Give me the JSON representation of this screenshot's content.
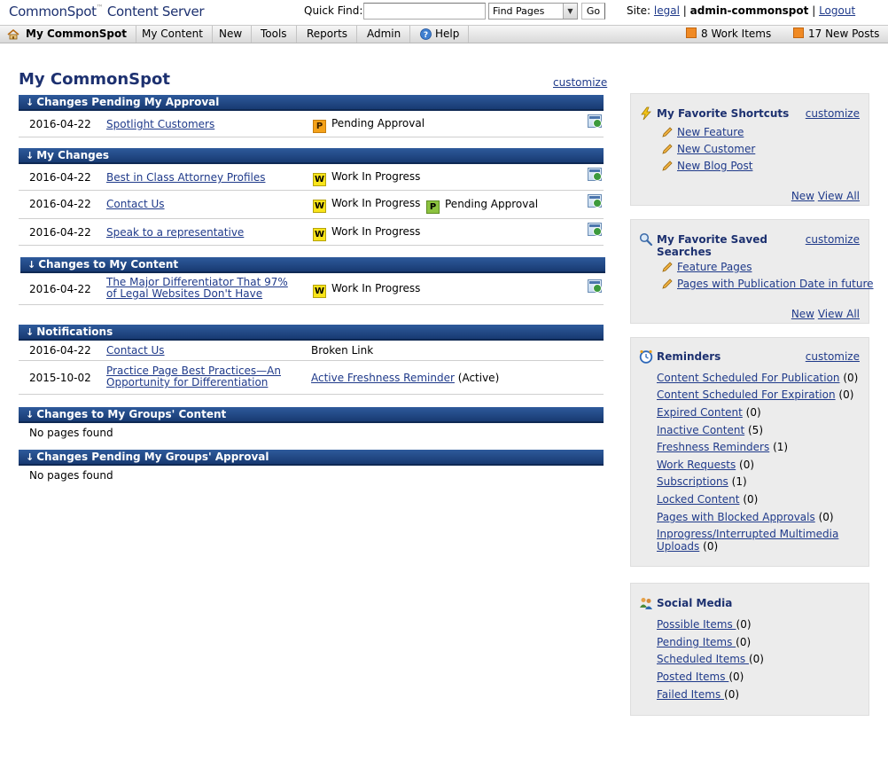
{
  "app": {
    "logo_name": "CommonSpot",
    "logo_tm": "™",
    "logo_product": "Content Server"
  },
  "quickfind": {
    "label": "Quick Find:",
    "input_value": "",
    "select_value": "Find Pages",
    "go_label": "Go"
  },
  "site": {
    "label": "Site:",
    "name": "legal",
    "separator": "|",
    "user": "admin-commonspot",
    "logout": "Logout"
  },
  "menu": {
    "items": [
      "My CommonSpot",
      "My Content",
      "New",
      "Tools",
      "Reports",
      "Admin",
      "Help"
    ],
    "work_items": "8 Work Items",
    "new_posts": "17 New Posts"
  },
  "main": {
    "title": "My CommonSpot",
    "customize": "customize",
    "arrow": "↓",
    "sections": [
      {
        "header": "Changes Pending My Approval",
        "rows": [
          {
            "date": "2016-04-22",
            "title": "Spotlight Customers",
            "status1_badge": "P",
            "status1": "Pending Approval"
          }
        ]
      },
      {
        "header": "My Changes",
        "rows": [
          {
            "date": "2016-04-22",
            "title": "Best in Class Attorney Profiles",
            "status1_badge": "W",
            "status1": "Work In Progress"
          },
          {
            "date": "2016-04-22",
            "title": "Contact Us",
            "status1_badge": "W",
            "status1": "Work In Progress",
            "status2_badge": "P",
            "status2": "Pending Approval"
          },
          {
            "date": "2016-04-22",
            "title": "Speak to a representative",
            "status1_badge": "W",
            "status1": "Work In Progress"
          }
        ]
      },
      {
        "header": "Changes to My Content",
        "rows": [
          {
            "date": "2016-04-22",
            "title_line1": "The Major Differentiator That 97%",
            "title_line2": "of Legal Websites Don't Have",
            "status1_badge": "W",
            "status1": "Work In Progress"
          }
        ]
      },
      {
        "header": "Notifications",
        "rows": [
          {
            "date": "2016-04-22",
            "title": "Contact Us",
            "note": "Broken Link"
          },
          {
            "date": "2015-10-02",
            "title_line1": "Practice Page Best Practices—An",
            "title_line2": "Opportunity for Differentiation",
            "note_link": "Active Freshness Reminder",
            "note_suffix": "(Active)"
          }
        ]
      },
      {
        "header": "Changes to My Groups' Content",
        "empty": "No pages found"
      },
      {
        "header": "Changes Pending My Groups' Approval",
        "empty": "No pages found"
      }
    ]
  },
  "sidebar": {
    "shortcuts": {
      "title": "My Favorite Shortcuts",
      "customize": "customize",
      "items": [
        "New Feature",
        "New Customer",
        "New Blog Post"
      ],
      "new": "New",
      "view_all": "View All"
    },
    "searches": {
      "title_line1": "My Favorite Saved",
      "title_line2": "Searches",
      "customize": "customize",
      "items": [
        "Feature Pages",
        "Pages with Publication Date in future"
      ],
      "new": "New",
      "view_all": "View All"
    },
    "reminders": {
      "title": "Reminders",
      "customize": "customize",
      "items": [
        {
          "label": "Content Scheduled For Publication",
          "count": "(0)"
        },
        {
          "label": "Content Scheduled For Expiration",
          "count": "(0)"
        },
        {
          "label": "Expired Content",
          "count": "(0)"
        },
        {
          "label": "Inactive Content",
          "count": "(5)"
        },
        {
          "label": "Freshness Reminders",
          "count": "(1)"
        },
        {
          "label": "Work Requests",
          "count": "(0)"
        },
        {
          "label": "Subscriptions",
          "count": "(1)"
        },
        {
          "label": "Locked Content",
          "count": "(0)"
        },
        {
          "label": "Pages with Blocked Approvals",
          "count": "(0)"
        },
        {
          "label_line1": "Inprogress/Interrupted Multimedia",
          "label_line2": "Uploads",
          "count": "(0)"
        }
      ]
    },
    "social": {
      "title": "Social Media",
      "items": [
        {
          "label": "Possible Items ",
          "count": "(0)"
        },
        {
          "label": "Pending Items ",
          "count": "(0)"
        },
        {
          "label": "Scheduled Items ",
          "count": "(0)"
        },
        {
          "label": "Posted Items ",
          "count": "(0)"
        },
        {
          "label": "Failed Items ",
          "count": "(0)"
        }
      ]
    }
  }
}
